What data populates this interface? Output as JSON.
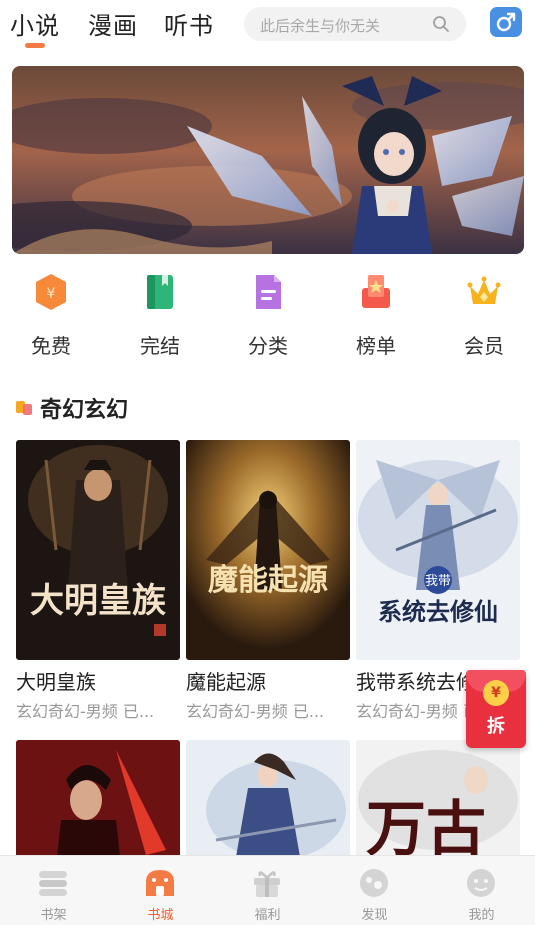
{
  "header": {
    "tabs": [
      {
        "label": "小说",
        "active": true
      },
      {
        "label": "漫画",
        "active": false
      },
      {
        "label": "听书",
        "active": false
      }
    ],
    "search": {
      "placeholder": "此后余生与你无关",
      "icon": "search-icon"
    },
    "gender_icon": "male-symbol-icon"
  },
  "banner": {
    "image": "anime-girl-with-crystal-wings"
  },
  "categories": [
    {
      "label": "免费",
      "icon": "coin-hexagon-icon"
    },
    {
      "label": "完结",
      "icon": "green-book-icon"
    },
    {
      "label": "分类",
      "icon": "document-list-icon"
    },
    {
      "label": "榜单",
      "icon": "ranking-ribbon-icon"
    },
    {
      "label": "会员",
      "icon": "crown-icon"
    }
  ],
  "section": {
    "title": "奇幻玄幻"
  },
  "books": [
    {
      "title": "大明皇族",
      "meta": "玄幻奇幻-男频 已...",
      "cover_text": "大明皇族"
    },
    {
      "title": "魔能起源",
      "meta": "玄幻奇幻-男频 已...",
      "cover_text": "魔能起源"
    },
    {
      "title": "我带系统去修仙",
      "meta": "玄幻奇幻-男频 已...",
      "cover_text": "系统去修仙",
      "cover_tag": "我带"
    },
    {
      "title": "",
      "meta": "",
      "cover_text": ""
    },
    {
      "title": "",
      "meta": "",
      "cover_text": ""
    },
    {
      "title": "",
      "meta": "",
      "cover_text": "万古"
    }
  ],
  "red_packet": {
    "label": "拆",
    "coin": "¥"
  },
  "bottom_nav": [
    {
      "label": "书架",
      "icon": "bookshelf-icon",
      "active": false
    },
    {
      "label": "书城",
      "icon": "bookstore-icon",
      "active": true
    },
    {
      "label": "福利",
      "icon": "gift-icon",
      "active": false
    },
    {
      "label": "发现",
      "icon": "discover-icon",
      "active": false
    },
    {
      "label": "我的",
      "icon": "profile-icon",
      "active": false
    }
  ],
  "colors": {
    "accent": "#f47b44",
    "active_nav": "#f0602e",
    "gender_button": "#4a90e2",
    "red_packet": "#e8303f"
  }
}
